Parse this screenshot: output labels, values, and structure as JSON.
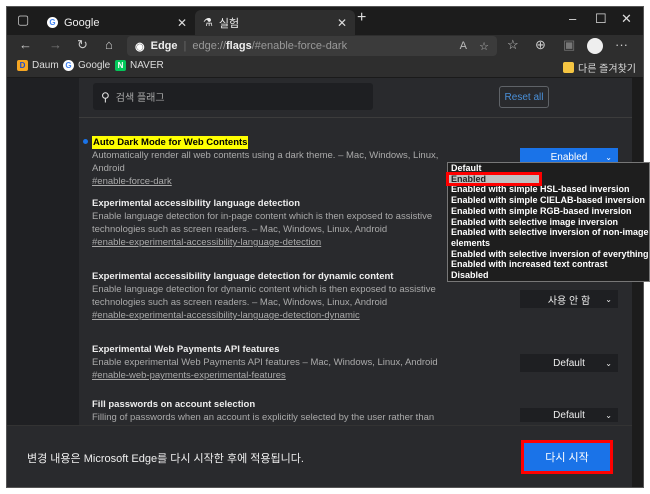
{
  "tabs": [
    {
      "label": "Google",
      "icon": "google-icon"
    },
    {
      "label": "실험",
      "icon": "flask-icon"
    }
  ],
  "address": {
    "brand": "Edge",
    "url_prefix": "edge://",
    "url_bold": "flags",
    "url_suffix": "/#enable-force-dark"
  },
  "bookmarks": [
    {
      "label": "Daum"
    },
    {
      "label": "Google"
    },
    {
      "label": "NAVER"
    }
  ],
  "other_favorites": "다른 즐겨찾기",
  "search": {
    "placeholder": "검색 플래그"
  },
  "reset_all": "Reset all",
  "flags": [
    {
      "title": "Auto Dark Mode for Web Contents",
      "desc": "Automatically render all web contents using a dark theme. – Mac, Windows, Linux, Android",
      "desc2": "",
      "link": "#enable-force-dark",
      "value": "Enabled"
    },
    {
      "title": "Experimental accessibility language detection",
      "desc": "Enable language detection for in-page content which is then exposed to assistive",
      "desc2": "technologies such as screen readers. – Mac, Windows, Linux, Android",
      "link": "#enable-experimental-accessibility-language-detection",
      "value": ""
    },
    {
      "title": "Experimental accessibility language detection for dynamic content",
      "desc": "Enable language detection for dynamic content which is then exposed to assistive",
      "desc2": "technologies such as screen readers. – Mac, Windows, Linux, Android",
      "link": "#enable-experimental-accessibility-language-detection-dynamic",
      "value": "사용 안 함"
    },
    {
      "title": "Experimental Web Payments API features",
      "desc": "Enable experimental Web Payments API features – Mac, Windows, Linux, Android",
      "desc2": "",
      "link": "#enable-web-payments-experimental-features",
      "value": "Default"
    },
    {
      "title": "Fill passwords on account selection",
      "desc": "Filling of passwords when an account is explicitly selected by the user rather than autofilling",
      "desc2": "",
      "link": "",
      "value": "Default"
    }
  ],
  "dropdown_options": [
    "Default",
    "Enabled",
    "Enabled with simple HSL-based inversion",
    "Enabled with simple CIELAB-based inversion",
    "Enabled with simple RGB-based inversion",
    "Enabled with selective image inversion",
    "Enabled with selective inversion of non-image elements",
    "Enabled with selective inversion of everything",
    "Enabled with increased text contrast",
    "Disabled"
  ],
  "bottom": {
    "message": "변경 내용은 Microsoft Edge를 다시 시작한 후에 적용됩니다.",
    "restart": "다시 시작"
  }
}
